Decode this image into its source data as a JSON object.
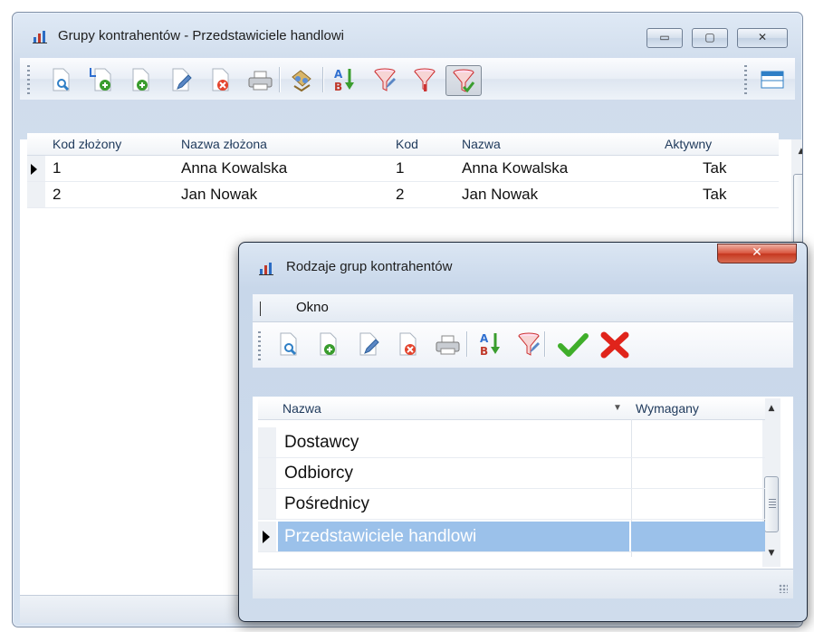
{
  "main_window": {
    "title": "Grupy kontrahentów - Przedstawiciele handlowi",
    "controls": {
      "minimize": "▭",
      "maximize": "▢",
      "close": "✕"
    },
    "toolbar_icons": [
      "preview-icon",
      "add-child-icon",
      "add-icon",
      "edit-icon",
      "delete-icon",
      "print-icon",
      "links-icon",
      "sort-az-icon",
      "filter-edit-icon",
      "filter-icon",
      "filter-active-icon",
      "layout-icon"
    ],
    "grid": {
      "columns": [
        "Kod złożony",
        "Nazwa złożona",
        "Kod",
        "Nazwa",
        "Aktywny"
      ],
      "rows": [
        [
          "1",
          "Anna Kowalska",
          "1",
          "Anna Kowalska",
          "Tak"
        ],
        [
          "2",
          "Jan Nowak",
          "2",
          "Jan Nowak",
          "Tak"
        ]
      ],
      "current_row": 0
    }
  },
  "dialog": {
    "title": "Rodzaje grup kontrahentów",
    "close_glyph": "✕",
    "menu": {
      "window_label": "Okno"
    },
    "toolbar_icons": [
      "preview-icon",
      "add-icon",
      "edit-icon",
      "delete-icon",
      "print-icon",
      "sort-az-icon",
      "filter-edit-icon",
      "accept-icon",
      "cancel-icon"
    ],
    "grid": {
      "columns": [
        "Nazwa",
        "Wymagany"
      ],
      "rows": [
        [
          "Dostawcy",
          ""
        ],
        [
          "Odbiorcy",
          ""
        ],
        [
          "Pośrednicy",
          ""
        ],
        [
          "Przedstawiciele handlowi",
          ""
        ]
      ],
      "selected_row": 3
    }
  },
  "colors": {
    "selection": "#9bc1ea",
    "accept": "#3fae2a",
    "cancel": "#e0241b",
    "close_button": "#c5371f"
  }
}
